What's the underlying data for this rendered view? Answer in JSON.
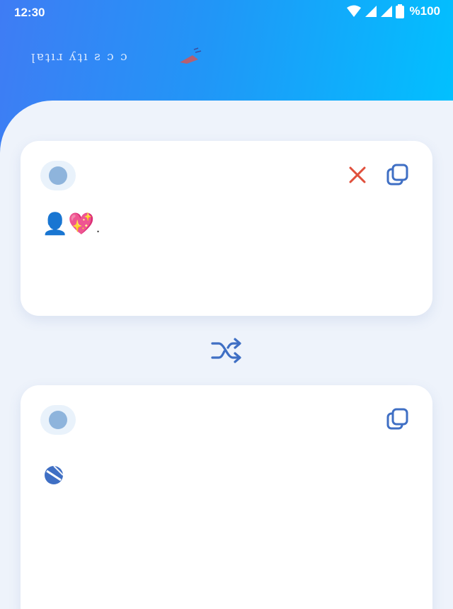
{
  "status": {
    "time": "12:30",
    "battery": "%100"
  },
  "header": {
    "title": "ꞁɐʇıɹ ʎʇı ƨ ɔ ɔ"
  },
  "source_card": {
    "text": "👤💖",
    "trailing": ".",
    "icons": [
      "close-icon",
      "copy-icon"
    ]
  },
  "swap": {
    "icon": "shuffle-icon"
  },
  "result_card": {
    "icons": [
      "copy-icon"
    ]
  },
  "colors": {
    "header_start": "#3f7cf4",
    "header_end": "#00c2ff",
    "background": "#eef3fb",
    "icon_blue": "#3f6fc4",
    "close_red": "#e0503c"
  }
}
